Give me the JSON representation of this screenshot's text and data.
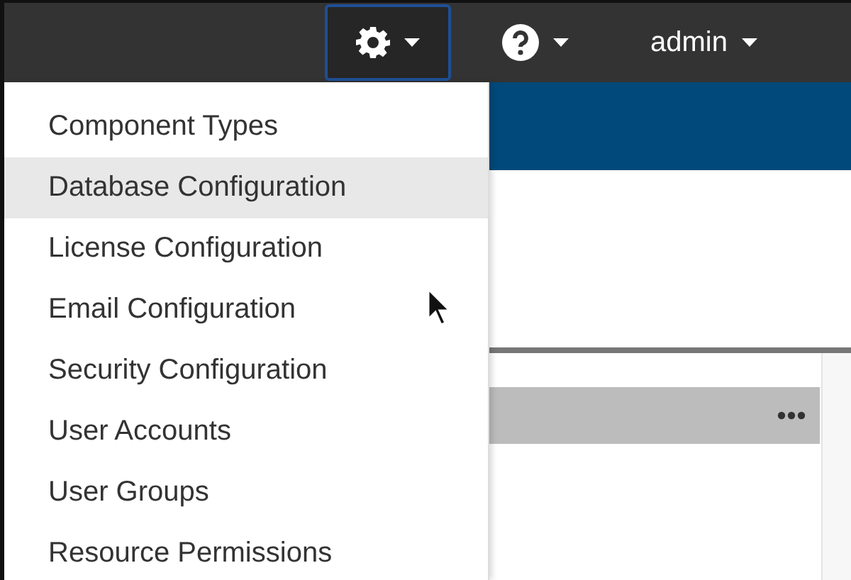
{
  "navbar": {
    "settings_menu": {
      "expanded": true
    },
    "user": {
      "label": "admin"
    }
  },
  "settings_menu": {
    "items": [
      {
        "label": "Component Types",
        "selected": false
      },
      {
        "label": "Database Configuration",
        "selected": true
      },
      {
        "label": "License Configuration",
        "selected": false
      },
      {
        "label": "Email Configuration",
        "selected": false
      },
      {
        "label": "Security Configuration",
        "selected": false
      },
      {
        "label": "User Accounts",
        "selected": false
      },
      {
        "label": "User Groups",
        "selected": false
      },
      {
        "label": "Resource Permissions",
        "selected": false
      }
    ]
  }
}
